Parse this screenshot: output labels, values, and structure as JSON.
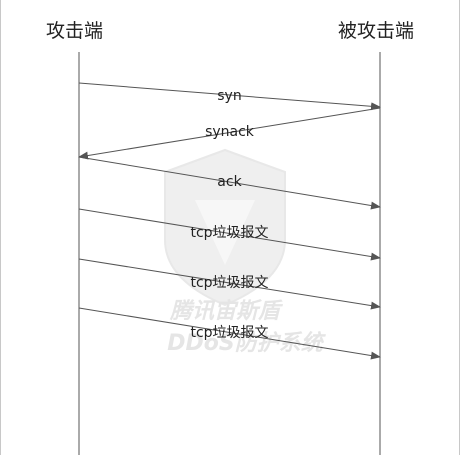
{
  "actors": {
    "left": "攻击端",
    "right": "被攻击端"
  },
  "messages": [
    {
      "label": "syn",
      "from": "left",
      "to": "right"
    },
    {
      "label": "synack",
      "from": "right",
      "to": "left"
    },
    {
      "label": "ack",
      "from": "left",
      "to": "right"
    },
    {
      "label": "tcp垃圾报文",
      "from": "left",
      "to": "right"
    },
    {
      "label": "tcp垃圾报文",
      "from": "left",
      "to": "right"
    },
    {
      "label": "tcp垃圾报文",
      "from": "left",
      "to": "right"
    }
  ],
  "watermark": {
    "line1": "腾讯宙斯盾",
    "line2": "DDoS防护系统"
  },
  "colors": {
    "line": "#555555",
    "text": "#222222",
    "watermark": "#d0d0d0"
  }
}
